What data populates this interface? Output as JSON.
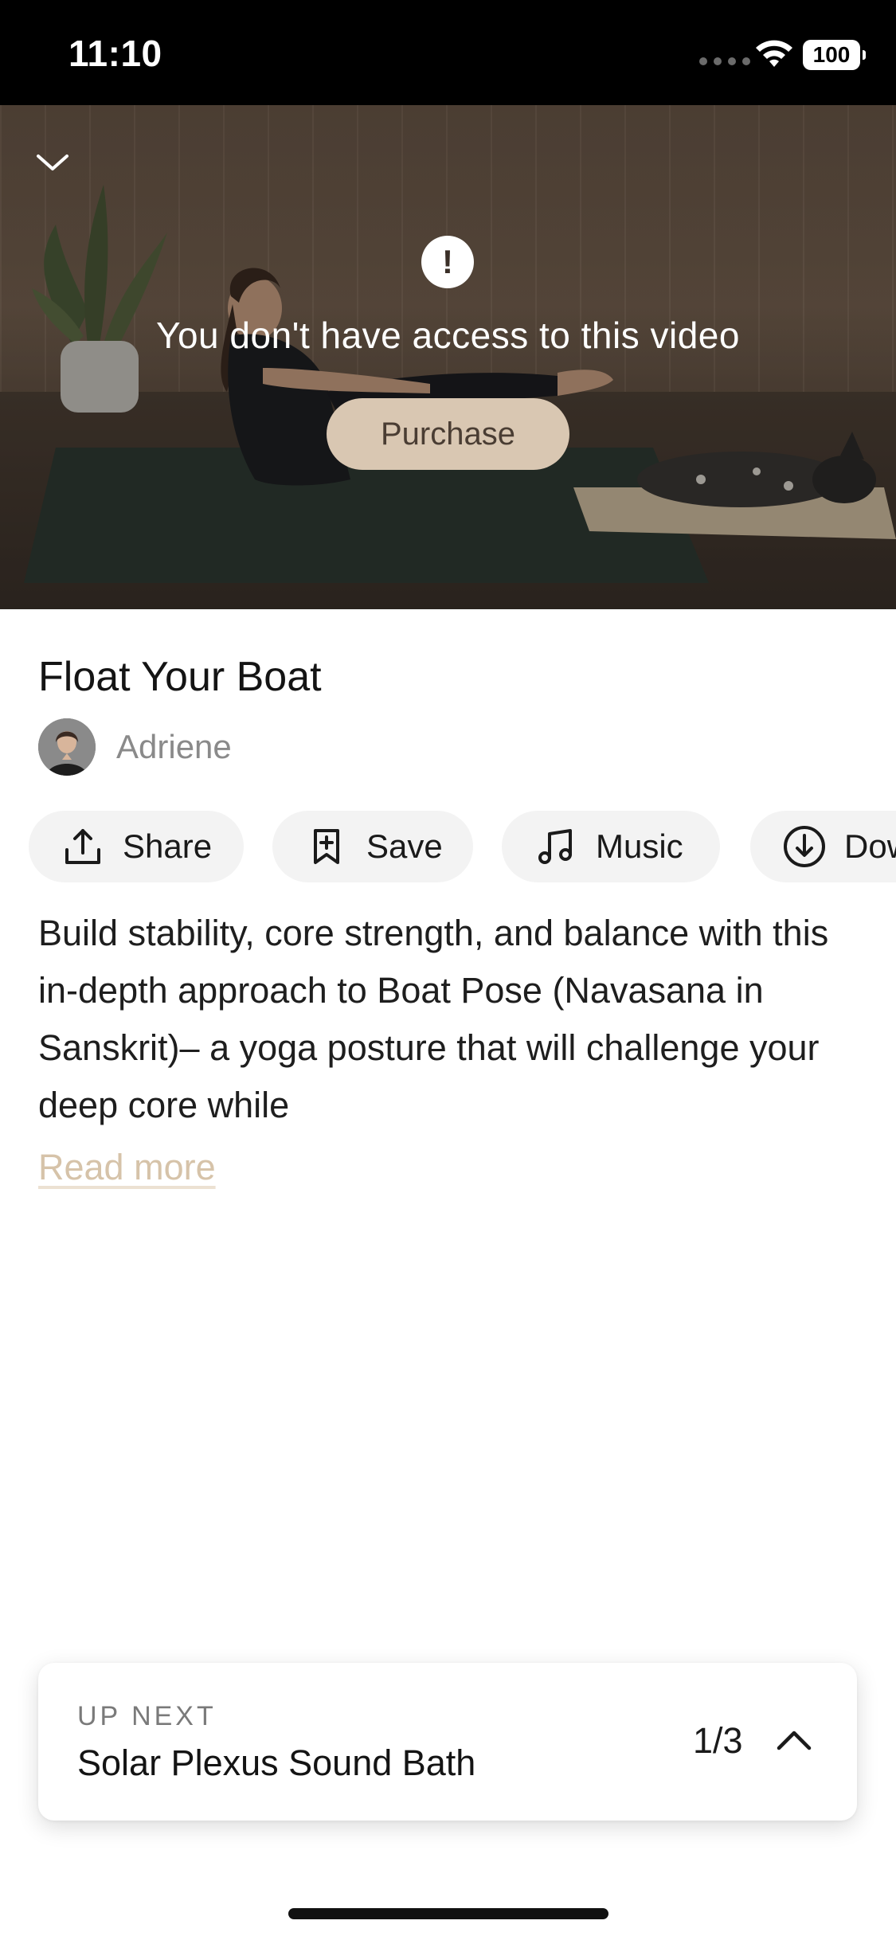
{
  "status_bar": {
    "time": "11:10",
    "battery": "100"
  },
  "video": {
    "access_message": "You don't have access to this video",
    "purchase_label": "Purchase"
  },
  "class": {
    "title": "Float Your Boat",
    "author": "Adriene"
  },
  "actions": [
    {
      "label": "Share",
      "icon": "share-icon"
    },
    {
      "label": "Save",
      "icon": "bookmark-add-icon"
    },
    {
      "label": "Music",
      "icon": "music-note-icon"
    },
    {
      "label": "Dow",
      "icon": "download-icon"
    }
  ],
  "description": {
    "text": "Build stability, core strength, and balance with this in-depth approach to Boat Pose (Navasana in Sanskrit)– a yoga posture that will challenge your deep core while",
    "read_more": "Read more"
  },
  "up_next": {
    "label": "UP NEXT",
    "title": "Solar Plexus Sound Bath",
    "position": "1/3"
  },
  "colors": {
    "accent": "#d9c7b2",
    "read_more": "#d6c3a9",
    "button_bg": "#f3f3f3"
  }
}
